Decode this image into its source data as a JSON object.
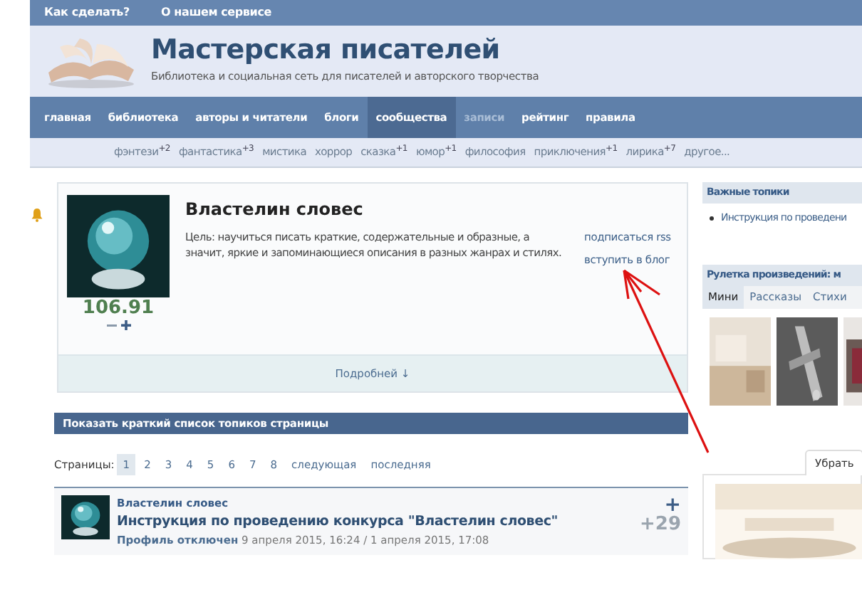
{
  "top_links": [
    "Как сделать?",
    "О нашем сервисе"
  ],
  "site": {
    "title": "Мастерская писателей",
    "subtitle": "Библиотека и социальная сеть для писателей и авторского творчества"
  },
  "nav": [
    {
      "label": "главная",
      "selected": false,
      "disabled": false
    },
    {
      "label": "библиотека",
      "selected": false,
      "disabled": false
    },
    {
      "label": "авторы и читатели",
      "selected": false,
      "disabled": false
    },
    {
      "label": "блоги",
      "selected": false,
      "disabled": false
    },
    {
      "label": "сообщества",
      "selected": true,
      "disabled": false
    },
    {
      "label": "записи",
      "selected": false,
      "disabled": true
    },
    {
      "label": "рейтинг",
      "selected": false,
      "disabled": false
    },
    {
      "label": "правила",
      "selected": false,
      "disabled": false
    }
  ],
  "genres": [
    {
      "label": "фэнтези",
      "count": "+2"
    },
    {
      "label": "фантастика",
      "count": "+3"
    },
    {
      "label": "мистика"
    },
    {
      "label": "хоррор"
    },
    {
      "label": "сказка",
      "count": "+1"
    },
    {
      "label": "юмор",
      "count": "+1"
    },
    {
      "label": "философия"
    },
    {
      "label": "приключения",
      "count": "+1"
    },
    {
      "label": "лирика",
      "count": "+7"
    },
    {
      "label": "другое..."
    }
  ],
  "blog": {
    "title": "Властелин словес",
    "description": "Цель: научиться писать краткие, содержательные и образные, а значит, яркие и запоминающиеся описания в разных жанрах и стилях.",
    "rating": "106.91",
    "links": [
      "подписаться rss",
      "вступить в блог"
    ],
    "more": "Подробней ↓"
  },
  "topics_bar": "Показать краткий список топиков страницы",
  "pagination": {
    "label": "Страницы:",
    "pages": [
      {
        "label": "1",
        "selected": true
      },
      {
        "label": "2",
        "selected": false
      },
      {
        "label": "3",
        "selected": false
      },
      {
        "label": "4",
        "selected": false
      },
      {
        "label": "5",
        "selected": false
      },
      {
        "label": "6",
        "selected": false
      },
      {
        "label": "7",
        "selected": false
      },
      {
        "label": "8",
        "selected": false
      }
    ],
    "next": "следующая",
    "last": "последняя"
  },
  "topic": {
    "blog": "Властелин словес",
    "title": "Инструкция по проведению конкурса \"Властелин словес\"",
    "author": "Профиль отключен",
    "dates": "9 апреля 2015, 16:24 / 1 апреля 2015, 17:08",
    "vote": "+",
    "score": "+29"
  },
  "sidebar": {
    "important": {
      "title": "Важные топики",
      "items": [
        "Инструкция по проведени"
      ]
    },
    "roulette": {
      "title": "Рулетка произведений: м",
      "tabs": [
        {
          "label": "Мини",
          "selected": true
        },
        {
          "label": "Рассказы",
          "selected": false
        },
        {
          "label": "Стихи",
          "selected": false
        }
      ]
    },
    "bottom_tab": "Убрать"
  }
}
